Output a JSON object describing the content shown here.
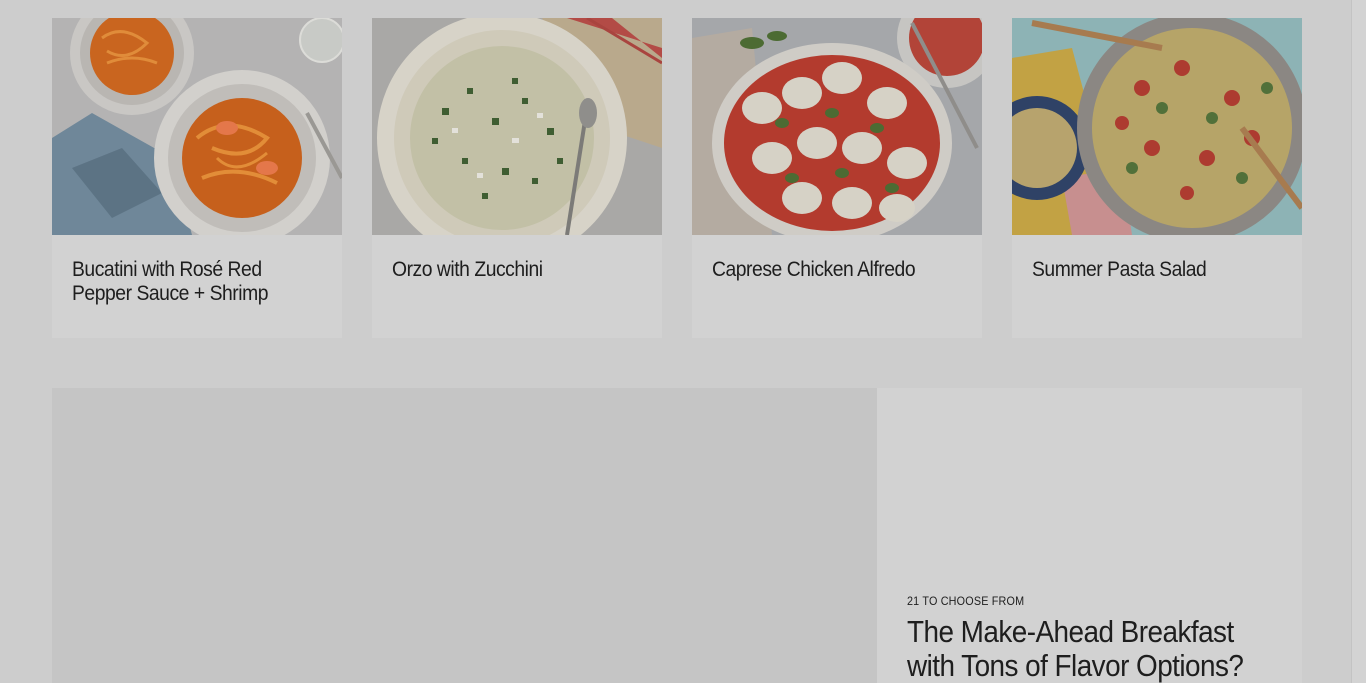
{
  "recipe_cards": [
    {
      "title": "Bucatini with Rosé Red Pepper Sauce + Shrimp",
      "image": "bucatini-shrimp-photo"
    },
    {
      "title": "Orzo with Zucchini",
      "image": "orzo-zucchini-photo"
    },
    {
      "title": "Caprese Chicken Alfredo",
      "image": "caprese-chicken-alfredo-photo"
    },
    {
      "title": "Summer Pasta Salad",
      "image": "summer-pasta-salad-photo"
    }
  ],
  "feature": {
    "kicker": "21 TO CHOOSE FROM",
    "headline": "The Make-Ahead Breakfast with Tons of Flavor Options?"
  },
  "colors": {
    "page_background": "#cdcdcd",
    "card_background": "#d2d2d2",
    "media_placeholder": "#c5c5c5",
    "text": "#1e1e1e"
  }
}
